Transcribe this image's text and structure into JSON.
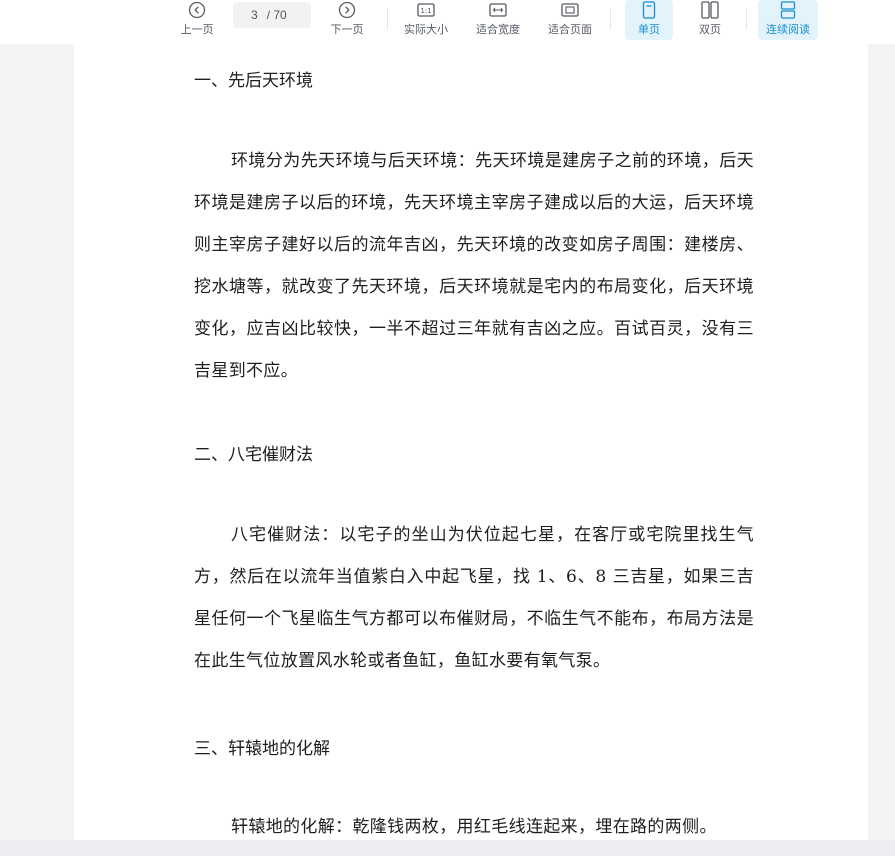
{
  "toolbar": {
    "prev_label": "上一页",
    "current_page": "3",
    "total_pages": "/ 70",
    "next_label": "下一页",
    "actual_size_label": "实际大小",
    "fit_width_label": "适合宽度",
    "fit_page_label": "适合页面",
    "single_page_label": "单页",
    "double_page_label": "双页",
    "continuous_label": "连续阅读",
    "accent_color": "#1a8fd0"
  },
  "document": {
    "sections": [
      {
        "heading": "一、先后天环境",
        "body": "环境分为先天环境与后天环境：先天环境是建房子之前的环境，后天环境是建房子以后的环境，先天环境主宰房子建成以后的大运，后天环境则主宰房子建好以后的流年吉凶，先天环境的改变如房子周围：建楼房、挖水塘等，就改变了先天环境，后天环境就是宅内的布局变化，后天环境变化，应吉凶比较快，一半不超过三年就有吉凶之应。百试百灵，没有三吉星到不应。"
      },
      {
        "heading": "二、八宅催财法",
        "body": "八宅催财法：以宅子的坐山为伏位起七星，在客厅或宅院里找生气方，然后在以流年当值紫白入中起飞星，找 1、6、8 三吉星，如果三吉星任何一个飞星临生气方都可以布催财局，不临生气不能布，布局方法是在此生气位放置风水轮或者鱼缸，鱼缸水要有氧气泵。"
      },
      {
        "heading": "三、轩辕地的化解",
        "body": "轩辕地的化解：乾隆钱两枚，用红毛线连起来，埋在路的两侧。"
      }
    ]
  }
}
